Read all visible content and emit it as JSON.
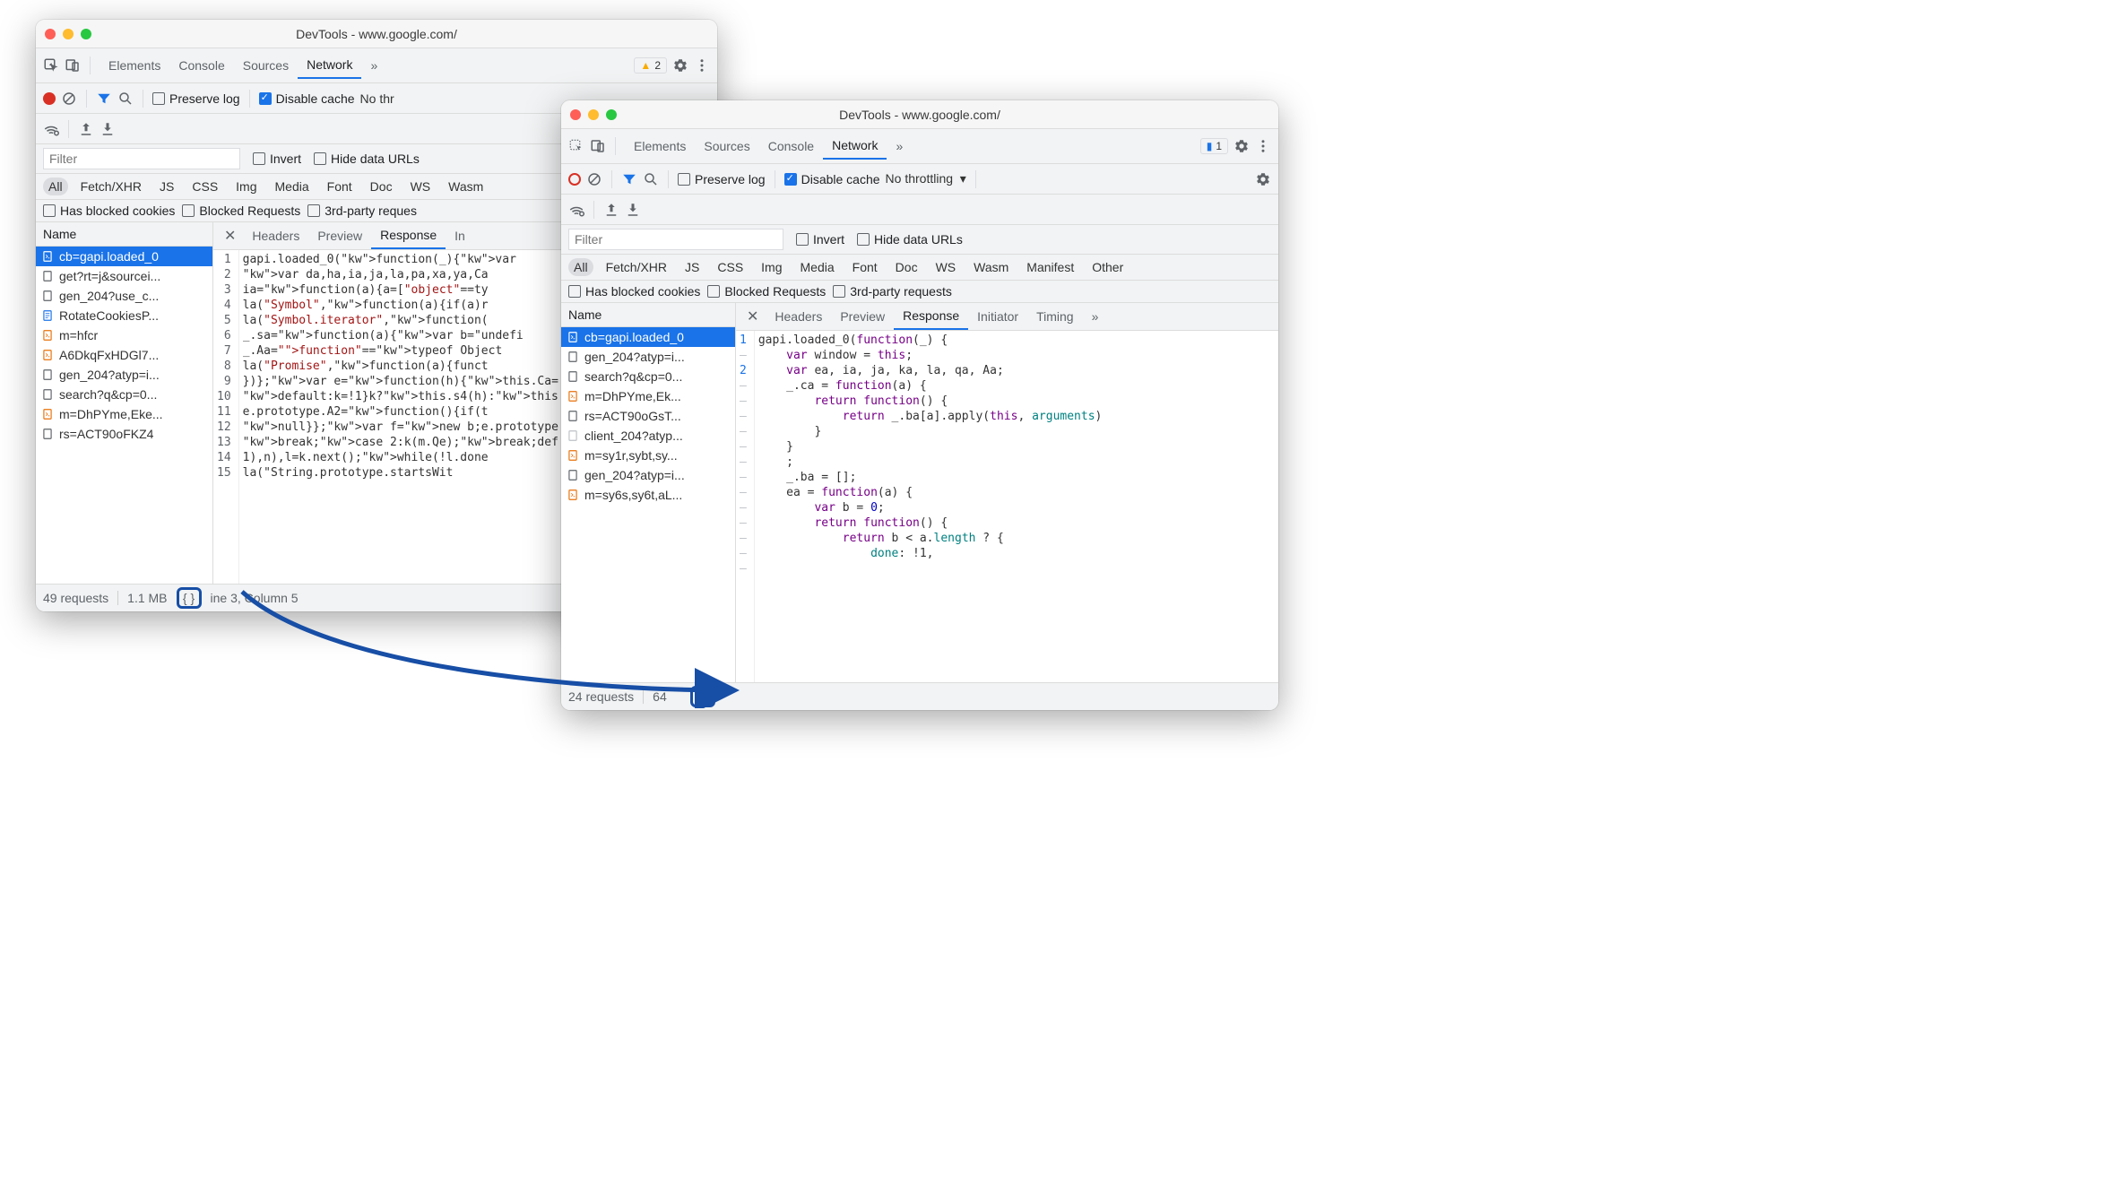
{
  "window1": {
    "title": "DevTools - www.google.com/",
    "tabs": [
      "Elements",
      "Console",
      "Sources",
      "Network"
    ],
    "active_tab": "Network",
    "warning_count": "2",
    "preserve_log": "Preserve log",
    "disable_cache": "Disable cache",
    "throttling": "No thr",
    "filter_placeholder": "Filter",
    "invert": "Invert",
    "hide_data_urls": "Hide data URLs",
    "type_chips": [
      "All",
      "Fetch/XHR",
      "JS",
      "CSS",
      "Img",
      "Media",
      "Font",
      "Doc",
      "WS",
      "Wasm"
    ],
    "has_blocked": "Has blocked cookies",
    "blocked_req": "Blocked Requests",
    "third_party": "3rd-party reques",
    "name_header": "Name",
    "requests": [
      {
        "name": "cb=gapi.loaded_0",
        "type": "js",
        "sel": true
      },
      {
        "name": "get?rt=j&sourcei...",
        "type": "doc"
      },
      {
        "name": "gen_204?use_c...",
        "type": "doc"
      },
      {
        "name": "RotateCookiesP...",
        "type": "page"
      },
      {
        "name": "m=hfcr",
        "type": "js"
      },
      {
        "name": "A6DkqFxHDGl7...",
        "type": "js"
      },
      {
        "name": "gen_204?atyp=i...",
        "type": "doc"
      },
      {
        "name": "search?q&cp=0...",
        "type": "doc"
      },
      {
        "name": "m=DhPYme,Eke...",
        "type": "js"
      },
      {
        "name": "rs=ACT90oFKZ4",
        "type": "doc"
      }
    ],
    "subtabs": [
      "Headers",
      "Preview",
      "Response",
      "In"
    ],
    "active_subtab": "Response",
    "code_lines": [
      "gapi.loaded_0(function(_){var ",
      "var da,ha,ia,ja,la,pa,xa,ya,Ca",
      "ia=function(a){a=[\"object\"==ty",
      "la(\"Symbol\",function(a){if(a)r",
      "la(\"Symbol.iterator\",function(",
      "_.sa=function(a){var b=\"undefi",
      "_.Aa=\"function\"==typeof Object",
      "la(\"Promise\",function(a){funct",
      "})};var e=function(h){this.Ca=",
      "default:k=!1}k?this.s4(h):this",
      "e.prototype.A2=function(){if(t",
      "null}};var f=new b;e.prototype",
      "break;case 2:k(m.Qe);break;def",
      "1),n),l=k.next();while(!l.done",
      "la(\"String.prototype.startsWit"
    ],
    "status_requests": "49 requests",
    "status_size": "1.1 MB",
    "status_cursor": "ine 3, Column 5"
  },
  "window2": {
    "title": "DevTools - www.google.com/",
    "tabs": [
      "Elements",
      "Sources",
      "Console",
      "Network"
    ],
    "active_tab": "Network",
    "msg_count": "1",
    "preserve_log": "Preserve log",
    "disable_cache": "Disable cache",
    "throttling": "No throttling",
    "filter_placeholder": "Filter",
    "invert": "Invert",
    "hide_data_urls": "Hide data URLs",
    "type_chips": [
      "All",
      "Fetch/XHR",
      "JS",
      "CSS",
      "Img",
      "Media",
      "Font",
      "Doc",
      "WS",
      "Wasm",
      "Manifest",
      "Other"
    ],
    "has_blocked": "Has blocked cookies",
    "blocked_req": "Blocked Requests",
    "third_party": "3rd-party requests",
    "name_header": "Name",
    "requests": [
      {
        "name": "cb=gapi.loaded_0",
        "type": "js",
        "sel": true
      },
      {
        "name": "gen_204?atyp=i...",
        "type": "doc"
      },
      {
        "name": "search?q&cp=0...",
        "type": "doc"
      },
      {
        "name": "m=DhPYme,Ek...",
        "type": "js"
      },
      {
        "name": "rs=ACT90oGsT...",
        "type": "doc"
      },
      {
        "name": "client_204?atyp...",
        "type": "img"
      },
      {
        "name": "m=sy1r,sybt,sy...",
        "type": "js"
      },
      {
        "name": "gen_204?atyp=i...",
        "type": "doc"
      },
      {
        "name": "m=sy6s,sy6t,aL...",
        "type": "js"
      }
    ],
    "subtabs": [
      "Headers",
      "Preview",
      "Response",
      "Initiator",
      "Timing"
    ],
    "active_subtab": "Response",
    "gutter": [
      "1",
      "-",
      "2",
      "-",
      "-",
      "-",
      "-",
      "-",
      "-",
      "-",
      "-",
      "-",
      "-",
      "-",
      "-",
      "-"
    ],
    "code_lines": [
      "gapi.loaded_0(function(_) {",
      "    var window = this;",
      "    var ea, ia, ja, ka, la, qa, Aa;",
      "    _.ca = function(a) {",
      "        return function() {",
      "            return _.ba[a].apply(this, arguments)",
      "        }",
      "    }",
      "    ;",
      "    _.ba = [];",
      "    ea = function(a) {",
      "        var b = 0;",
      "        return function() {",
      "            return b < a.length ? {",
      "                done: !1,"
    ],
    "status_requests": "24 requests",
    "status_size": "64"
  }
}
